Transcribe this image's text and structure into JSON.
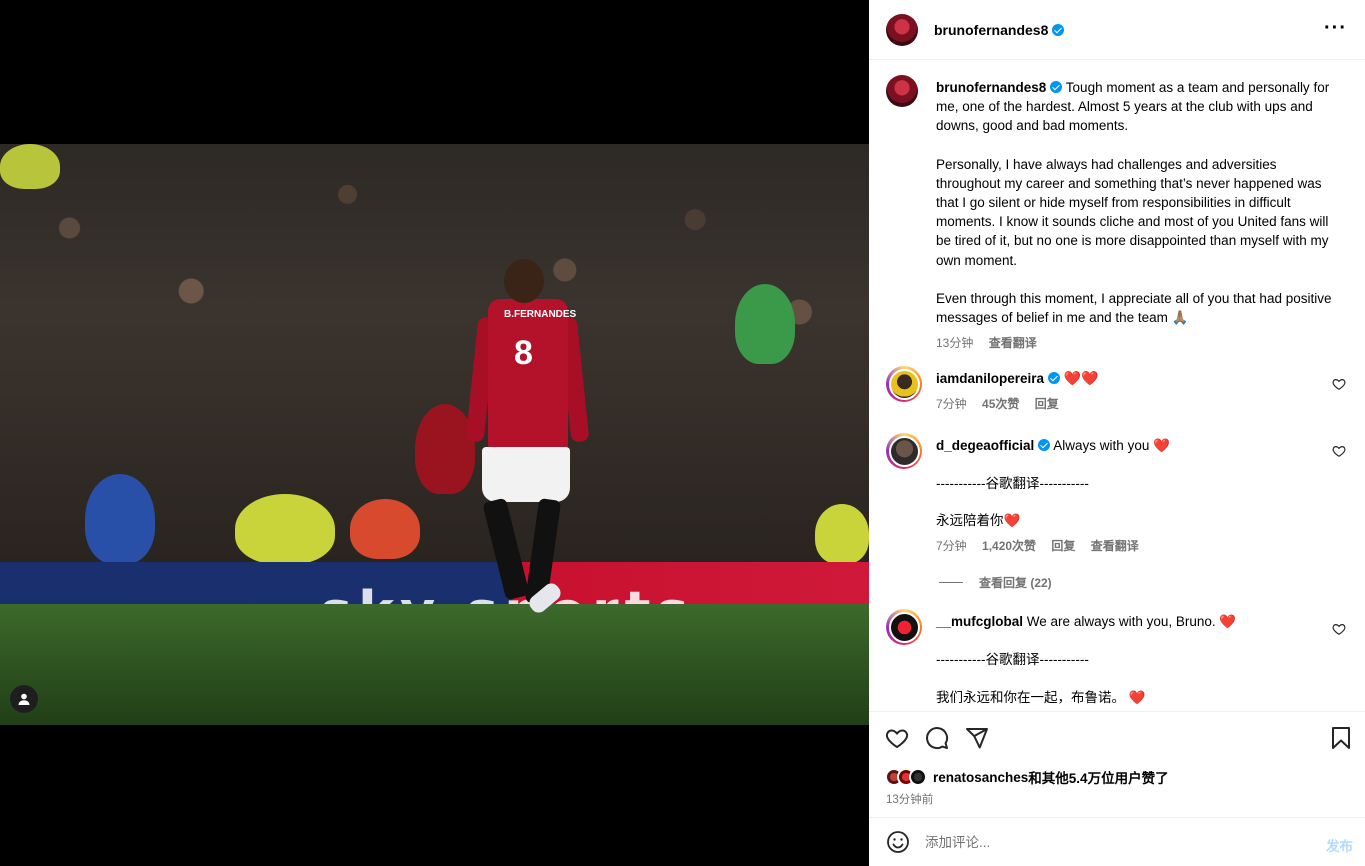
{
  "post": {
    "author": "brunofernandes8",
    "more_icon": "more-horizontal-icon",
    "caption_paragraphs": [
      "Tough moment as a team and personally for me, one of the hardest. Almost 5 years at the club with ups and downs, good and bad moments.",
      "Personally, I have always had challenges and adversities throughout my career and something that’s never happened was that I go silent or hide myself from responsibilities in difficult moments. I know it sounds cliche and most of you United fans will be tired of it, but no one is more disappointed than myself with my own moment.",
      "Even through this moment, I appreciate all of you that had positive messages of belief in me and the team 🙏🏽"
    ],
    "caption_time": "13分钟",
    "see_translation": "查看翻译"
  },
  "media": {
    "banner_text": "sky sports",
    "shirt_name": "B.FERNANDES",
    "shirt_number": "8",
    "user_tag_icon": "user-tag-icon"
  },
  "comments": [
    {
      "username": "iamdanilopereira",
      "verified": true,
      "text": "❤️❤️",
      "time": "7分钟",
      "likes": "45次赞",
      "reply": "回复"
    },
    {
      "username": "d_degeaofficial",
      "verified": true,
      "text": "Always with you ❤️",
      "translation_divider": "-----------谷歌翻译-----------",
      "translation": "永远陪着你❤️",
      "time": "7分钟",
      "likes": "1,420次赞",
      "reply": "回复",
      "see_translation": "查看翻译",
      "view_replies": "查看回复 (22)"
    },
    {
      "username": "__mufcglobal",
      "verified": false,
      "text": "We are always with you, Bruno. ❤️",
      "translation_divider": "-----------谷歌翻译-----------",
      "translation": "我们永远和你在一起，布鲁诺。 ❤️"
    }
  ],
  "actions": {
    "liked_by_user": "renatosanches",
    "liked_by_rest": "和其他5.4万位用户赞了",
    "post_time": "13分钟前"
  },
  "comment_box": {
    "placeholder": "添加评论...",
    "post_label": "发布"
  },
  "colors": {
    "verified_blue": "#0095f6",
    "heart_red": "#e0245e",
    "secondary_text": "#737373",
    "post_button_disabled": "#b3dbff"
  }
}
